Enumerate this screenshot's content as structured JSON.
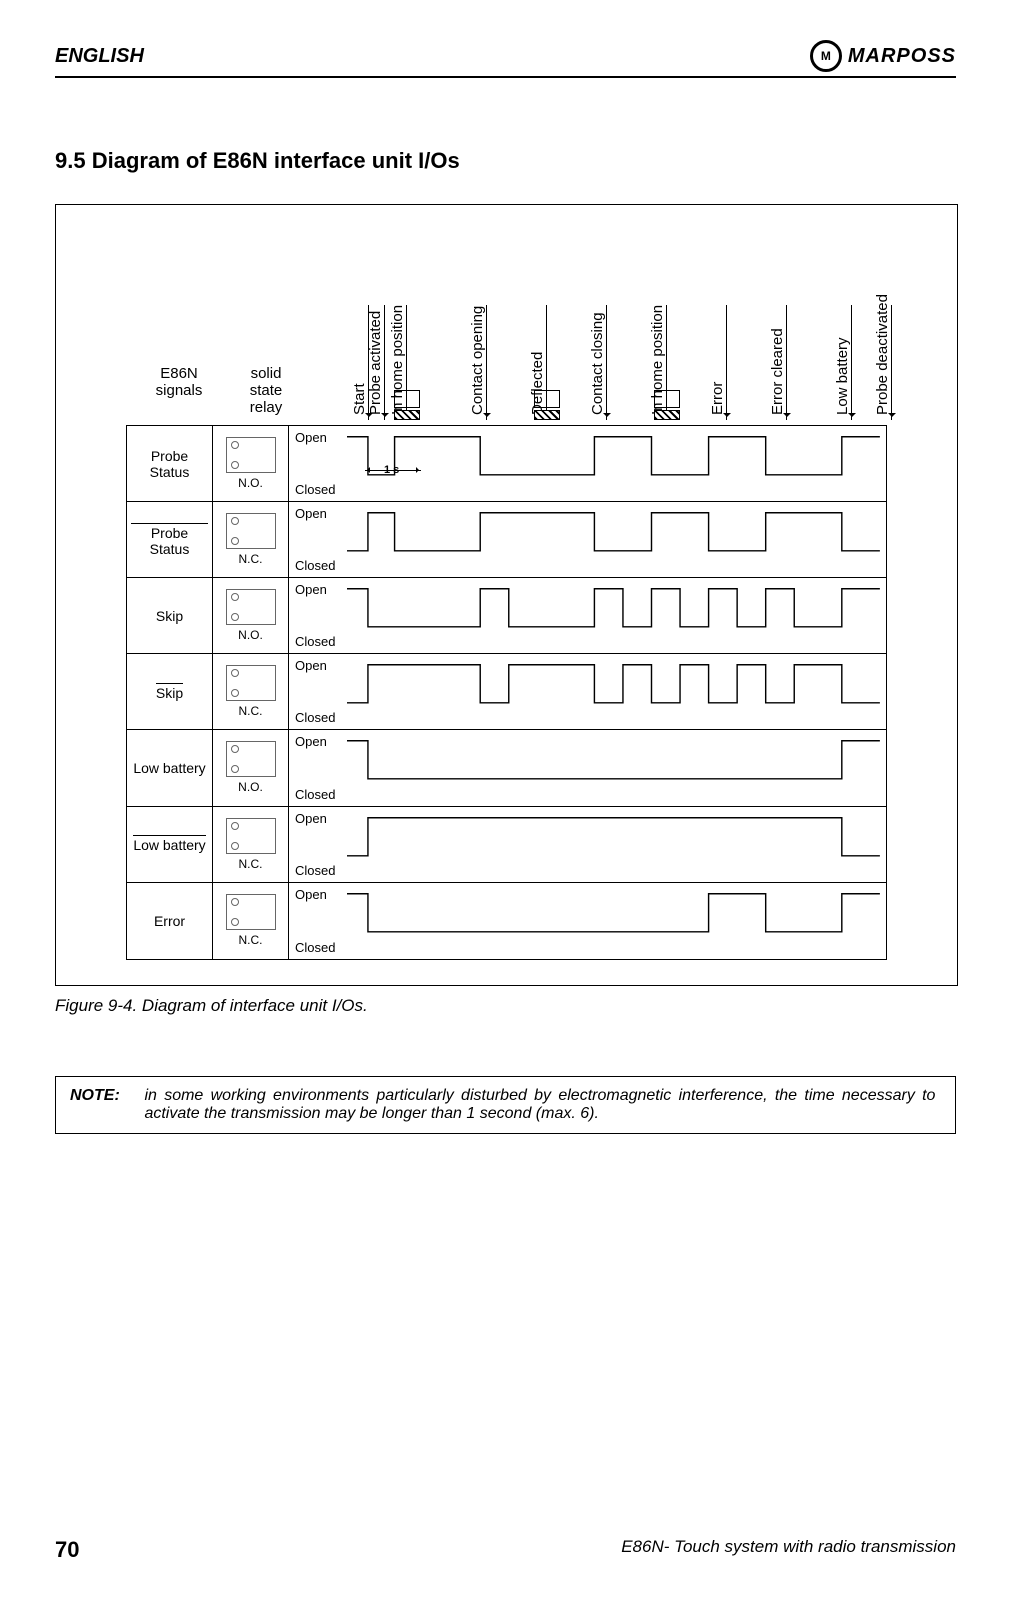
{
  "header": {
    "language": "ENGLISH",
    "brand": "MARPOSS",
    "brand_mark": "M"
  },
  "section": {
    "number": "9.5",
    "title": "Diagram of E86N interface unit I/Os"
  },
  "figure": {
    "caption": "Figure 9-4. Diagram of interface unit I/Os."
  },
  "diagram": {
    "column_headers": {
      "signals": "E86N signals",
      "relay": "solid\nstate\nrelay"
    },
    "events": [
      "Start",
      "Probe activated",
      "In home position",
      "Contact opening",
      "Deflected",
      "Contact closing",
      "In home position",
      "Error",
      "Error cleared",
      "Low battery",
      "Probe deactivated"
    ],
    "state_labels": {
      "open": "Open",
      "closed": "Closed"
    },
    "time_marker": "1 s",
    "rows": [
      {
        "name": "Probe Status",
        "overline": false,
        "relay": "N.O.",
        "show_time_marker": true,
        "wave": [
          [
            0,
            1
          ],
          [
            22,
            1
          ],
          [
            22,
            0
          ],
          [
            50,
            0
          ],
          [
            50,
            1
          ],
          [
            140,
            1
          ],
          [
            140,
            0
          ],
          [
            260,
            0
          ],
          [
            260,
            1
          ],
          [
            320,
            1
          ],
          [
            320,
            0
          ],
          [
            380,
            0
          ],
          [
            380,
            1
          ],
          [
            440,
            1
          ],
          [
            440,
            0
          ],
          [
            520,
            0
          ],
          [
            520,
            1
          ],
          [
            560,
            1
          ]
        ]
      },
      {
        "name": "Probe Status",
        "overline": true,
        "relay": "N.C.",
        "wave": [
          [
            0,
            0
          ],
          [
            22,
            0
          ],
          [
            22,
            1
          ],
          [
            50,
            1
          ],
          [
            50,
            0
          ],
          [
            140,
            0
          ],
          [
            140,
            1
          ],
          [
            260,
            1
          ],
          [
            260,
            0
          ],
          [
            320,
            0
          ],
          [
            320,
            1
          ],
          [
            380,
            1
          ],
          [
            380,
            0
          ],
          [
            440,
            0
          ],
          [
            440,
            1
          ],
          [
            520,
            1
          ],
          [
            520,
            0
          ],
          [
            560,
            0
          ]
        ]
      },
      {
        "name": "Skip",
        "overline": false,
        "relay": "N.O.",
        "wave": [
          [
            0,
            1
          ],
          [
            22,
            1
          ],
          [
            22,
            0
          ],
          [
            140,
            0
          ],
          [
            140,
            1
          ],
          [
            170,
            1
          ],
          [
            170,
            0
          ],
          [
            260,
            0
          ],
          [
            260,
            1
          ],
          [
            290,
            1
          ],
          [
            290,
            0
          ],
          [
            320,
            0
          ],
          [
            320,
            1
          ],
          [
            350,
            1
          ],
          [
            350,
            0
          ],
          [
            380,
            0
          ],
          [
            380,
            1
          ],
          [
            410,
            1
          ],
          [
            410,
            0
          ],
          [
            440,
            0
          ],
          [
            440,
            1
          ],
          [
            470,
            1
          ],
          [
            470,
            0
          ],
          [
            520,
            0
          ],
          [
            520,
            1
          ],
          [
            560,
            1
          ]
        ]
      },
      {
        "name": "Skip",
        "overline": true,
        "relay": "N.C.",
        "wave": [
          [
            0,
            0
          ],
          [
            22,
            0
          ],
          [
            22,
            1
          ],
          [
            140,
            1
          ],
          [
            140,
            0
          ],
          [
            170,
            0
          ],
          [
            170,
            1
          ],
          [
            260,
            1
          ],
          [
            260,
            0
          ],
          [
            290,
            0
          ],
          [
            290,
            1
          ],
          [
            320,
            1
          ],
          [
            320,
            0
          ],
          [
            350,
            0
          ],
          [
            350,
            1
          ],
          [
            380,
            1
          ],
          [
            380,
            0
          ],
          [
            410,
            0
          ],
          [
            410,
            1
          ],
          [
            440,
            1
          ],
          [
            440,
            0
          ],
          [
            470,
            0
          ],
          [
            470,
            1
          ],
          [
            520,
            1
          ],
          [
            520,
            0
          ],
          [
            560,
            0
          ]
        ]
      },
      {
        "name": "Low battery",
        "overline": false,
        "relay": "N.O.",
        "wave": [
          [
            0,
            1
          ],
          [
            22,
            1
          ],
          [
            22,
            0
          ],
          [
            520,
            0
          ],
          [
            520,
            1
          ],
          [
            560,
            1
          ]
        ]
      },
      {
        "name": "Low battery",
        "overline": true,
        "relay": "N.C.",
        "wave": [
          [
            0,
            0
          ],
          [
            22,
            0
          ],
          [
            22,
            1
          ],
          [
            520,
            1
          ],
          [
            520,
            0
          ],
          [
            560,
            0
          ]
        ]
      },
      {
        "name": "Error",
        "overline": false,
        "relay": "N.C.",
        "wave": [
          [
            0,
            1
          ],
          [
            22,
            1
          ],
          [
            22,
            0
          ],
          [
            380,
            0
          ],
          [
            380,
            1
          ],
          [
            440,
            1
          ],
          [
            440,
            0
          ],
          [
            520,
            0
          ],
          [
            520,
            1
          ],
          [
            560,
            1
          ]
        ]
      }
    ]
  },
  "note": {
    "label": "NOTE:",
    "text": "in some working environments particularly disturbed by electromagnetic interference, the time necessary to activate the transmission may be longer than 1 second (max. 6)."
  },
  "footer": {
    "page": "70",
    "doc": "E86N- Touch system with radio transmission"
  }
}
